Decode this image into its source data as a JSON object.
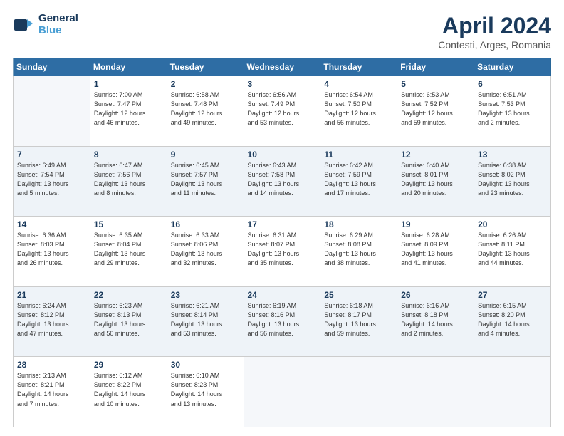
{
  "header": {
    "logo_line1": "General",
    "logo_line2": "Blue",
    "title": "April 2024",
    "subtitle": "Contesti, Arges, Romania"
  },
  "calendar": {
    "days_of_week": [
      "Sunday",
      "Monday",
      "Tuesday",
      "Wednesday",
      "Thursday",
      "Friday",
      "Saturday"
    ],
    "weeks": [
      [
        {
          "num": "",
          "info": ""
        },
        {
          "num": "1",
          "info": "Sunrise: 7:00 AM\nSunset: 7:47 PM\nDaylight: 12 hours\nand 46 minutes."
        },
        {
          "num": "2",
          "info": "Sunrise: 6:58 AM\nSunset: 7:48 PM\nDaylight: 12 hours\nand 49 minutes."
        },
        {
          "num": "3",
          "info": "Sunrise: 6:56 AM\nSunset: 7:49 PM\nDaylight: 12 hours\nand 53 minutes."
        },
        {
          "num": "4",
          "info": "Sunrise: 6:54 AM\nSunset: 7:50 PM\nDaylight: 12 hours\nand 56 minutes."
        },
        {
          "num": "5",
          "info": "Sunrise: 6:53 AM\nSunset: 7:52 PM\nDaylight: 12 hours\nand 59 minutes."
        },
        {
          "num": "6",
          "info": "Sunrise: 6:51 AM\nSunset: 7:53 PM\nDaylight: 13 hours\nand 2 minutes."
        }
      ],
      [
        {
          "num": "7",
          "info": "Sunrise: 6:49 AM\nSunset: 7:54 PM\nDaylight: 13 hours\nand 5 minutes."
        },
        {
          "num": "8",
          "info": "Sunrise: 6:47 AM\nSunset: 7:56 PM\nDaylight: 13 hours\nand 8 minutes."
        },
        {
          "num": "9",
          "info": "Sunrise: 6:45 AM\nSunset: 7:57 PM\nDaylight: 13 hours\nand 11 minutes."
        },
        {
          "num": "10",
          "info": "Sunrise: 6:43 AM\nSunset: 7:58 PM\nDaylight: 13 hours\nand 14 minutes."
        },
        {
          "num": "11",
          "info": "Sunrise: 6:42 AM\nSunset: 7:59 PM\nDaylight: 13 hours\nand 17 minutes."
        },
        {
          "num": "12",
          "info": "Sunrise: 6:40 AM\nSunset: 8:01 PM\nDaylight: 13 hours\nand 20 minutes."
        },
        {
          "num": "13",
          "info": "Sunrise: 6:38 AM\nSunset: 8:02 PM\nDaylight: 13 hours\nand 23 minutes."
        }
      ],
      [
        {
          "num": "14",
          "info": "Sunrise: 6:36 AM\nSunset: 8:03 PM\nDaylight: 13 hours\nand 26 minutes."
        },
        {
          "num": "15",
          "info": "Sunrise: 6:35 AM\nSunset: 8:04 PM\nDaylight: 13 hours\nand 29 minutes."
        },
        {
          "num": "16",
          "info": "Sunrise: 6:33 AM\nSunset: 8:06 PM\nDaylight: 13 hours\nand 32 minutes."
        },
        {
          "num": "17",
          "info": "Sunrise: 6:31 AM\nSunset: 8:07 PM\nDaylight: 13 hours\nand 35 minutes."
        },
        {
          "num": "18",
          "info": "Sunrise: 6:29 AM\nSunset: 8:08 PM\nDaylight: 13 hours\nand 38 minutes."
        },
        {
          "num": "19",
          "info": "Sunrise: 6:28 AM\nSunset: 8:09 PM\nDaylight: 13 hours\nand 41 minutes."
        },
        {
          "num": "20",
          "info": "Sunrise: 6:26 AM\nSunset: 8:11 PM\nDaylight: 13 hours\nand 44 minutes."
        }
      ],
      [
        {
          "num": "21",
          "info": "Sunrise: 6:24 AM\nSunset: 8:12 PM\nDaylight: 13 hours\nand 47 minutes."
        },
        {
          "num": "22",
          "info": "Sunrise: 6:23 AM\nSunset: 8:13 PM\nDaylight: 13 hours\nand 50 minutes."
        },
        {
          "num": "23",
          "info": "Sunrise: 6:21 AM\nSunset: 8:14 PM\nDaylight: 13 hours\nand 53 minutes."
        },
        {
          "num": "24",
          "info": "Sunrise: 6:19 AM\nSunset: 8:16 PM\nDaylight: 13 hours\nand 56 minutes."
        },
        {
          "num": "25",
          "info": "Sunrise: 6:18 AM\nSunset: 8:17 PM\nDaylight: 13 hours\nand 59 minutes."
        },
        {
          "num": "26",
          "info": "Sunrise: 6:16 AM\nSunset: 8:18 PM\nDaylight: 14 hours\nand 2 minutes."
        },
        {
          "num": "27",
          "info": "Sunrise: 6:15 AM\nSunset: 8:20 PM\nDaylight: 14 hours\nand 4 minutes."
        }
      ],
      [
        {
          "num": "28",
          "info": "Sunrise: 6:13 AM\nSunset: 8:21 PM\nDaylight: 14 hours\nand 7 minutes."
        },
        {
          "num": "29",
          "info": "Sunrise: 6:12 AM\nSunset: 8:22 PM\nDaylight: 14 hours\nand 10 minutes."
        },
        {
          "num": "30",
          "info": "Sunrise: 6:10 AM\nSunset: 8:23 PM\nDaylight: 14 hours\nand 13 minutes."
        },
        {
          "num": "",
          "info": ""
        },
        {
          "num": "",
          "info": ""
        },
        {
          "num": "",
          "info": ""
        },
        {
          "num": "",
          "info": ""
        }
      ]
    ]
  }
}
